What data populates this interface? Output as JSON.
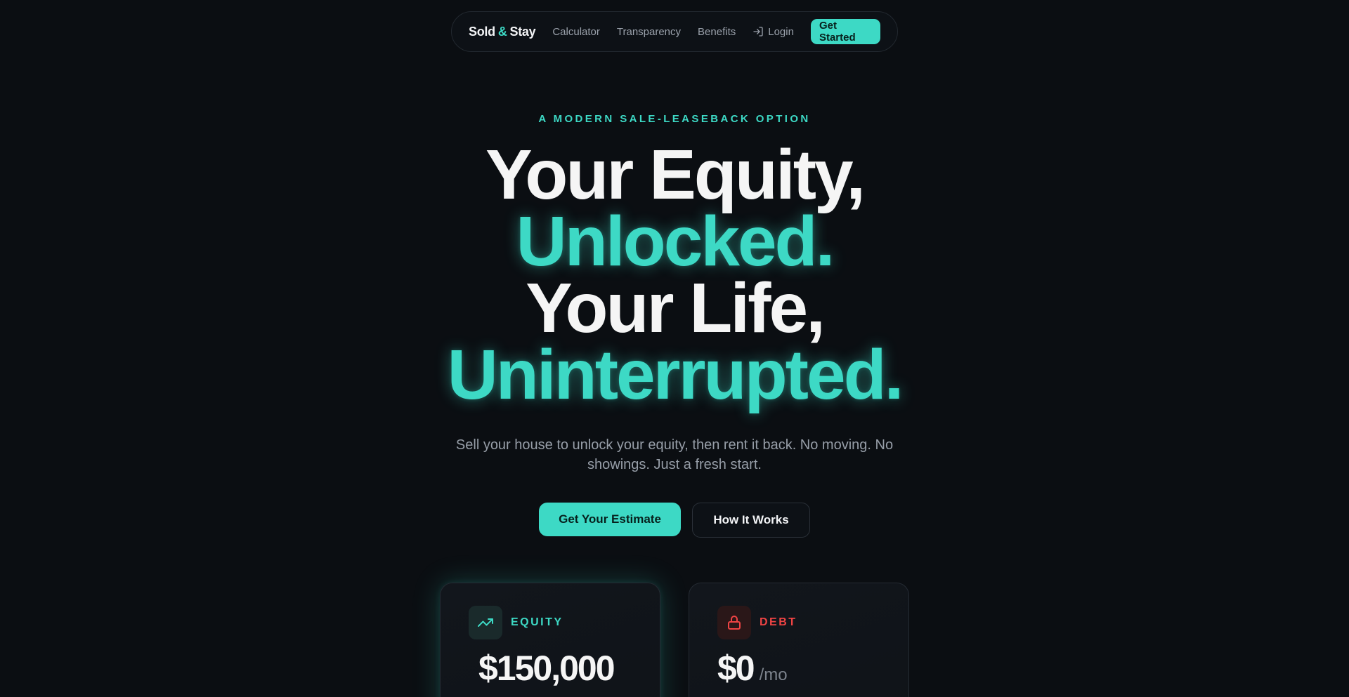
{
  "nav": {
    "logo_part1": "Sold",
    "logo_amp": "&",
    "logo_part2": "Stay",
    "links": [
      "Calculator",
      "Transparency",
      "Benefits"
    ],
    "login_label": "Login",
    "cta_label": "Get Started"
  },
  "hero": {
    "eyebrow": "A MODERN SALE-LEASEBACK OPTION",
    "line1": "Your Equity,",
    "line2": "Unlocked.",
    "line3": "Your Life,",
    "line4": "Uninterrupted.",
    "subtitle": "Sell your house to unlock your equity, then rent it back. No moving. No showings. Just a fresh start.",
    "primary_button": "Get Your Estimate",
    "secondary_button": "How It Works"
  },
  "cards": [
    {
      "label": "EQUITY",
      "value": "$150,000",
      "suffix": "",
      "icon": "trending-up-icon"
    },
    {
      "label": "DEBT",
      "value": "$0",
      "suffix": "/mo",
      "icon": "lock-icon"
    }
  ],
  "colors": {
    "background": "#0b0e12",
    "accent": "#3dd9c5",
    "danger": "#ef4444",
    "muted_text": "#979ea8"
  }
}
